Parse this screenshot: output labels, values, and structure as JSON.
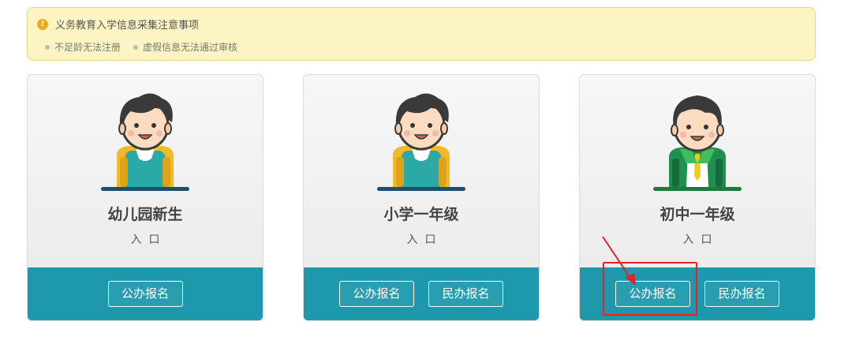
{
  "notice": {
    "icon": "info-icon",
    "icon_glyph": "!",
    "title": "义务教育入学信息采集注意事项",
    "items": [
      "不足龄无法注册",
      "虚假信息无法通过审核"
    ]
  },
  "cards": [
    {
      "title": "幼儿园新生",
      "subtitle": "入口",
      "avatar": "boy-with-backpack-avatar",
      "buttons": [
        "公办报名"
      ]
    },
    {
      "title": "小学一年级",
      "subtitle": "入口",
      "avatar": "boy-with-backpack-avatar",
      "buttons": [
        "公办报名",
        "民办报名"
      ]
    },
    {
      "title": "初中一年级",
      "subtitle": "入口",
      "avatar": "boy-in-uniform-avatar",
      "buttons": [
        "公办报名",
        "民办报名"
      ]
    }
  ],
  "colors": {
    "accent": "#1d98ad",
    "notice_bg": "#fcf4c2",
    "annotation": "#e3222a"
  }
}
